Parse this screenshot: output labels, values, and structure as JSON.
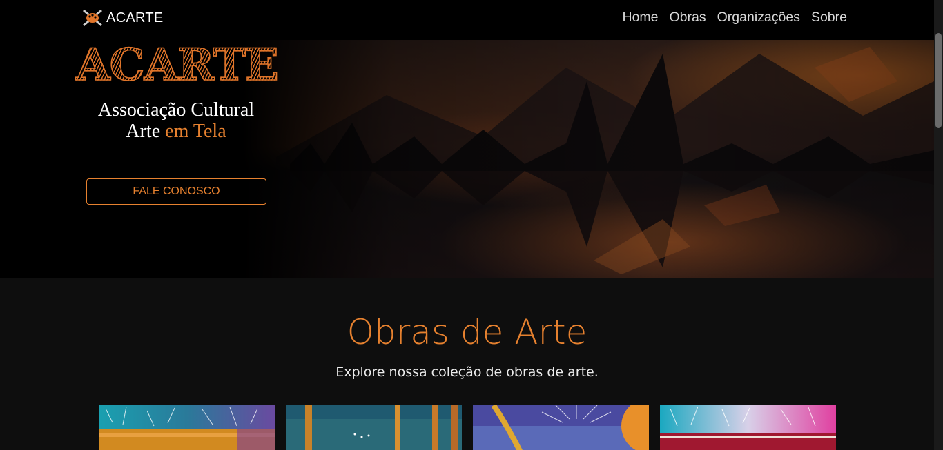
{
  "navbar": {
    "brand": "ACARTE",
    "links": [
      "Home",
      "Obras",
      "Organizações",
      "Sobre"
    ]
  },
  "hero": {
    "logo_title": "ACARTE",
    "subtitle_line1": "Associação Cultural",
    "subtitle_line2_a": "Arte",
    "subtitle_line2_b": "em Tela",
    "cta_label": "FALE CONOSCO"
  },
  "gallery": {
    "title": "Obras de Arte",
    "subtitle": "Explore nossa coleção de obras de arte."
  },
  "colors": {
    "accent": "#e6812f",
    "nav_bg": "#000000",
    "page_bg": "#0e0e0e"
  },
  "icons": [
    "palette-logo-icon"
  ]
}
